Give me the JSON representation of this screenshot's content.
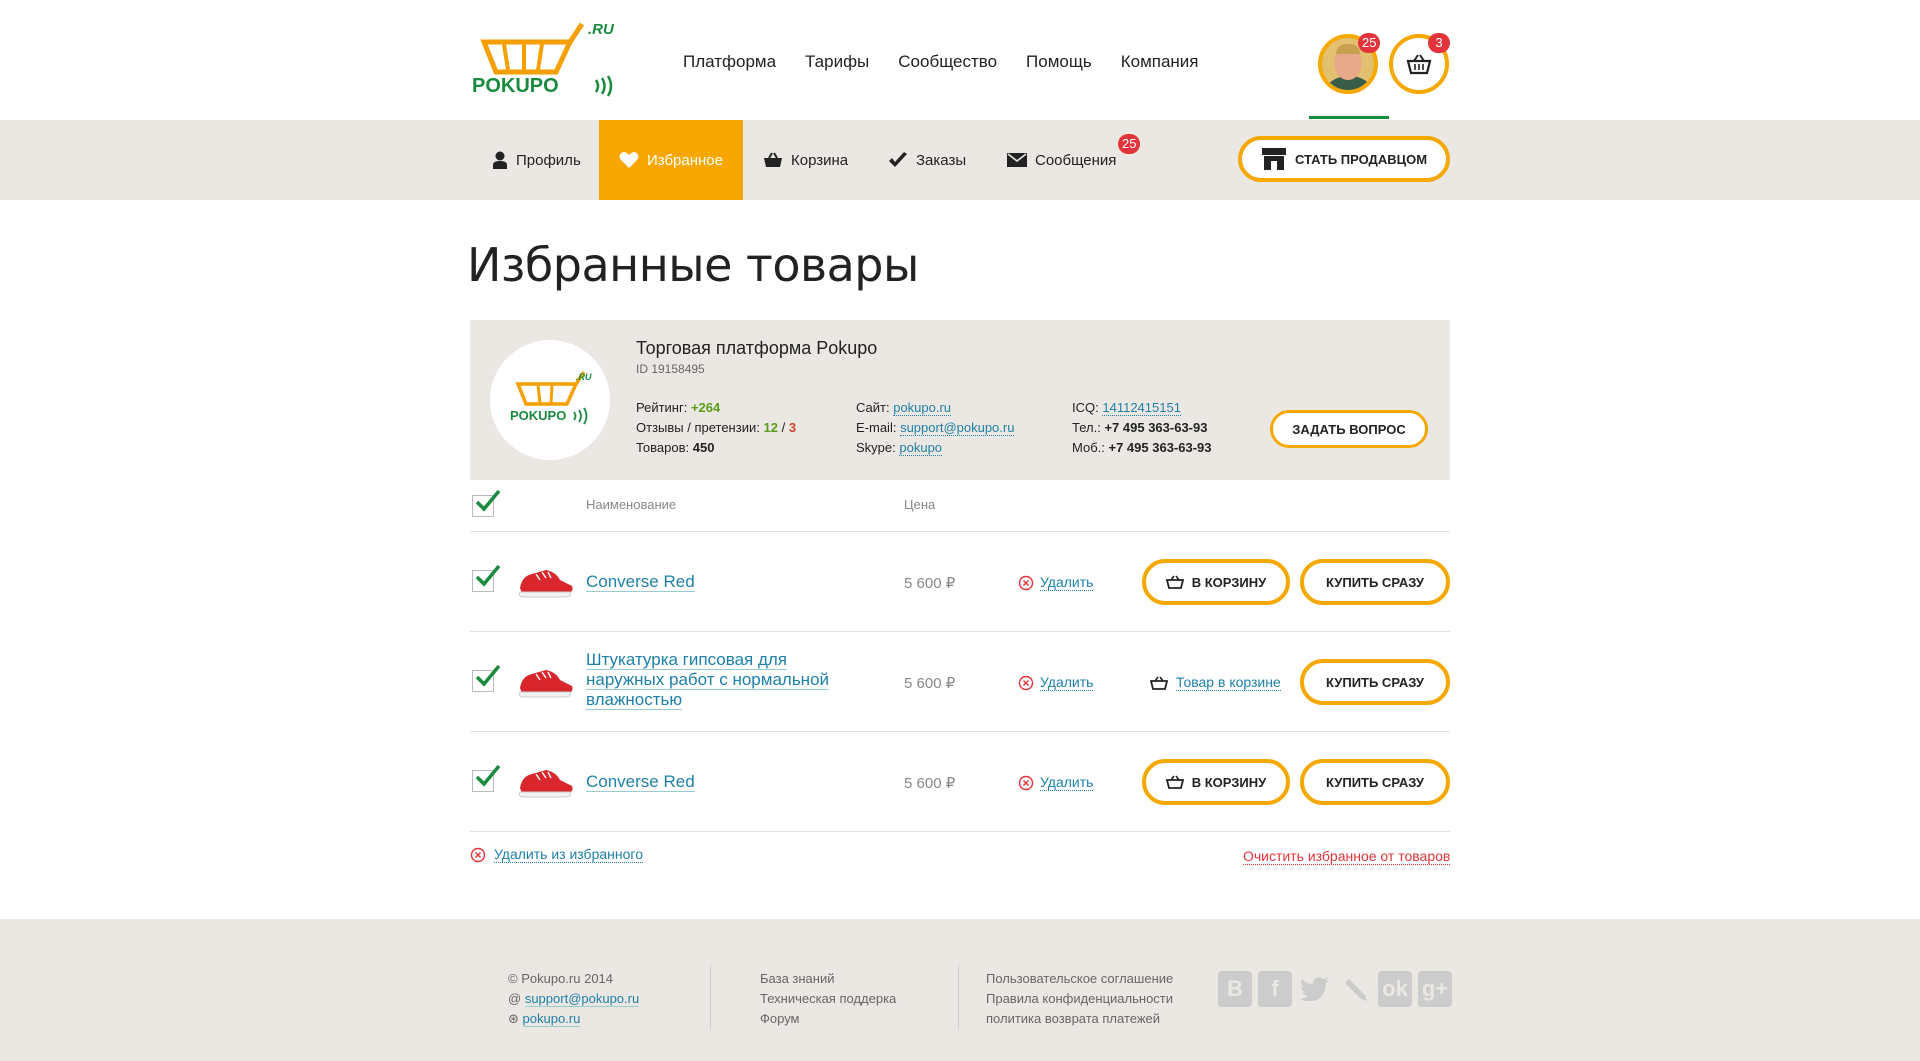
{
  "brand": {
    "logo_text": "POKUPO",
    "logo_suffix": ".RU",
    "accent": "#f7a700",
    "green": "#1a8a3f"
  },
  "header": {
    "nav": [
      "Платформа",
      "Тарифы",
      "Сообщество",
      "Помощь",
      "Компания"
    ],
    "user_badge": "25",
    "cart_badge": "3"
  },
  "subnav": {
    "profile": "Профиль",
    "favorites": "Избранное",
    "cart": "Корзина",
    "orders": "Заказы",
    "messages": "Сообщения",
    "messages_badge": "25",
    "seller_button": "СТАТЬ ПРОДАВЦОМ"
  },
  "page_title": "Избранные товары",
  "shop": {
    "title": "Торговая платформа Pokupo",
    "id": "ID 19158495",
    "rating_label": "Рейтинг:",
    "rating_value": "+264",
    "reviews_label": "Отзывы / претензии:",
    "reviews_positive": "12",
    "reviews_sep": "/",
    "reviews_negative": "3",
    "goods_label": "Товаров:",
    "goods_value": "450",
    "site_label": "Сайт:",
    "site_value": "pokupo.ru",
    "email_label": "E-mail:",
    "email_value": "support@pokupo.ru",
    "skype_label": "Skype:",
    "skype_value": "pokupo",
    "icq_label": "ICQ:",
    "icq_value": "14112415151",
    "tel_label": "Тел.:",
    "tel_value": "+7 495 363-63-93",
    "mob_label": "Моб.:",
    "mob_value": "+7 495 363-63-93",
    "ask_button": "ЗАДАТЬ ВОПРОС"
  },
  "table": {
    "col_name": "Наименование",
    "col_price": "Цена",
    "rows": [
      {
        "name": "Converse Red",
        "price": "5 600 ₽",
        "delete": "Удалить",
        "in_cart": false,
        "to_cart": "В КОРЗИНУ",
        "buy": "КУПИТЬ СРАЗУ"
      },
      {
        "name": "Штукатурка гипсовая для наружных работ с нормальной влажностью",
        "price": "5 600 ₽",
        "delete": "Удалить",
        "in_cart": true,
        "in_cart_label": "Товар в корзине",
        "buy": "КУПИТЬ СРАЗУ"
      },
      {
        "name": "Converse Red",
        "price": "5 600 ₽",
        "delete": "Удалить",
        "in_cart": false,
        "to_cart": "В КОРЗИНУ",
        "buy": "КУПИТЬ СРАЗУ"
      }
    ]
  },
  "actions": {
    "remove_favorites": "Удалить из избранного",
    "clear_favorites": "Очистить избранное от товаров"
  },
  "footer": {
    "copyright": "Pokupo.ru 2014",
    "email": "support@pokupo.ru",
    "skype": "pokupo.ru",
    "links_1": [
      "База знаний",
      "Техническая поддерка",
      "Форум"
    ],
    "links_2": [
      "Пользовательское соглашение",
      "Правила конфиденциальности",
      "политика возврата платежей"
    ],
    "social": [
      "vk-icon",
      "facebook-icon",
      "twitter-icon",
      "livejournal-icon",
      "odnoklassniki-icon",
      "google-plus-icon"
    ]
  }
}
